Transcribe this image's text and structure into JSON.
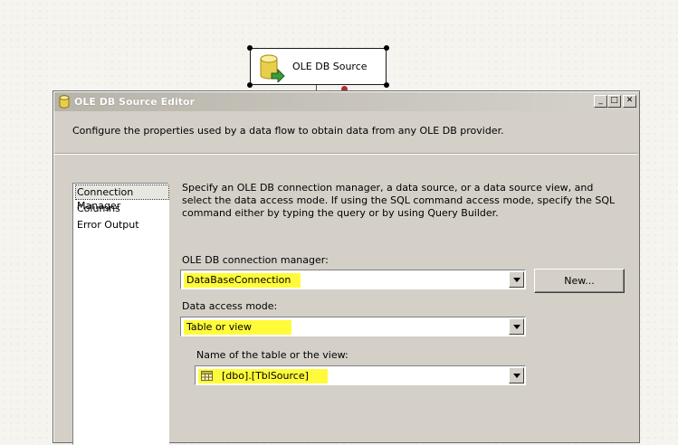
{
  "canvas": {
    "component_label": "OLE DB Source",
    "component_icon": "database-source-icon"
  },
  "dialog": {
    "title": "OLE DB Source Editor",
    "title_icon": "database-icon",
    "window_buttons": {
      "minimize": "_",
      "maximize": "□",
      "close": "✕"
    },
    "header_description": "Configure the properties used by a data flow to obtain data from any OLE DB provider.",
    "nav": {
      "items": [
        {
          "label": "Connection Manager",
          "selected": true
        },
        {
          "label": "Columns",
          "selected": false
        },
        {
          "label": "Error Output",
          "selected": false
        }
      ]
    },
    "instructions": "Specify an OLE DB connection manager, a data source, or a data source view, and select the data access mode. If using the SQL command access mode, specify the SQL command either by typing the query or by using Query Builder.",
    "connection_manager": {
      "label": "OLE DB connection manager:",
      "value": "DataBaseConnection",
      "new_button": "New..."
    },
    "access_mode": {
      "label": "Data access mode:",
      "value": "Table or view"
    },
    "table": {
      "label": "Name of the table or the view:",
      "value": "[dbo].[TblSource]",
      "icon": "table-icon"
    },
    "highlight_color": "#fffb3a"
  }
}
